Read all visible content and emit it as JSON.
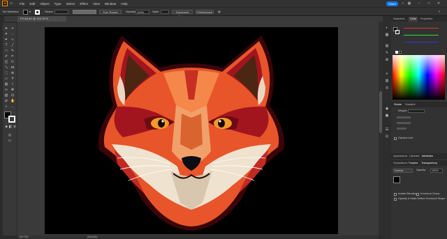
{
  "menubar": {
    "logo": "Ai",
    "items": [
      "File",
      "Edit",
      "Object",
      "Type",
      "Select",
      "Effect",
      "View",
      "Window",
      "Help"
    ],
    "share_label": "Share"
  },
  "controlbar": {
    "selection_label": "No Selection",
    "stroke_label": "Stroke:",
    "brush_label": "5 pt. Round",
    "opacity_label": "Opacity:",
    "opacity_value": "100%",
    "style_label": "Style:",
    "document_setup": "Document Setup",
    "preferences": "Preferences"
  },
  "document_tab": {
    "title": "FX Art.ai* @ 104.76 % (RGB/Preview)"
  },
  "statusbar": {
    "zoom": "104.76%",
    "tool": "Selection"
  },
  "panels": {
    "top_tabs": [
      "Swatches",
      "Color",
      "Properties"
    ],
    "stroke_tabs": [
      "Stroke",
      "Gradient"
    ],
    "weight_label": "Weight:",
    "dashed_line_label": "Dashed Line",
    "appearance_tabs": [
      "Appearance",
      "Libraries",
      "Attributes"
    ],
    "layers_tabs": [
      "Separations Preview",
      "Layers",
      "Transparency"
    ],
    "blend_mode": "Normal",
    "opacity_label": "Opacity:",
    "opacity_value": "100%",
    "isolate_blending": "Isolate Blending",
    "knockout_group": "Knockout Group",
    "opacity_mask": "Opacity & Mask Define Knockout Shape"
  },
  "colors": {
    "accent": "#1473e6",
    "artboard": "#000000",
    "fox_orange": "#e8552a",
    "fox_dark_red": "#a3151e"
  }
}
